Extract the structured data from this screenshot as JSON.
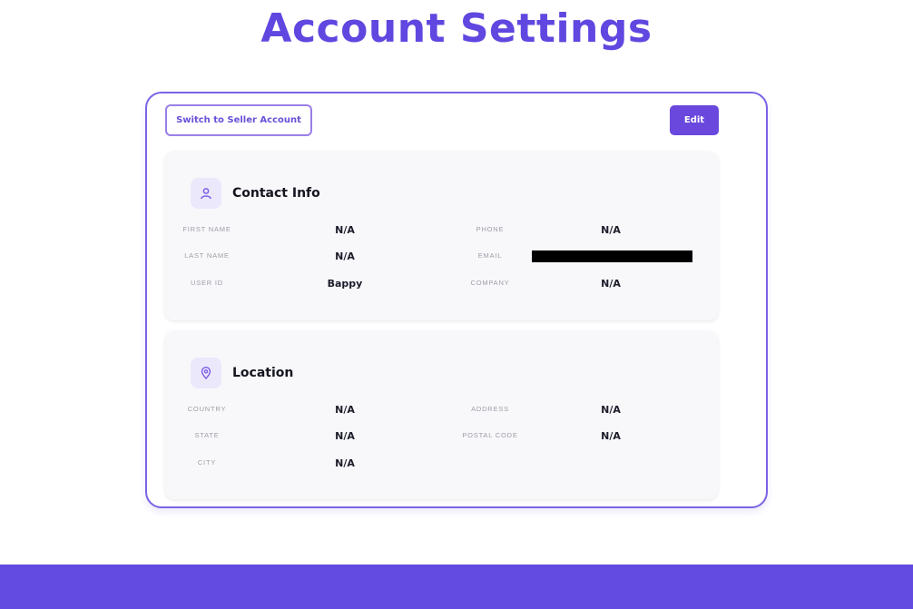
{
  "page": {
    "title": "Account Settings"
  },
  "toolbar": {
    "switch_label": "Switch to Seller Account",
    "edit_label": "Edit"
  },
  "contact": {
    "title": "Contact Info",
    "icon": "user-icon",
    "fields": [
      {
        "label": "FIRST NAME",
        "value": "N/A"
      },
      {
        "label": "LAST NAME",
        "value": "N/A"
      },
      {
        "label": "USER ID",
        "value": "Bappy"
      },
      {
        "label": "PHONE",
        "value": "N/A"
      },
      {
        "label": "EMAIL",
        "value": ""
      },
      {
        "label": "COMPANY",
        "value": "N/A"
      }
    ]
  },
  "location": {
    "title": "Location",
    "icon": "map-pin-icon",
    "fields": [
      {
        "label": "COUNTRY",
        "value": "N/A"
      },
      {
        "label": "STATE",
        "value": "N/A"
      },
      {
        "label": "CITY",
        "value": "N/A"
      },
      {
        "label": "ADDRESS",
        "value": "N/A"
      },
      {
        "label": "POSTAL CODE",
        "value": "N/A"
      }
    ]
  },
  "colors": {
    "accent": "#6047e0",
    "button": "#6a48dd",
    "band": "#634ae0"
  }
}
